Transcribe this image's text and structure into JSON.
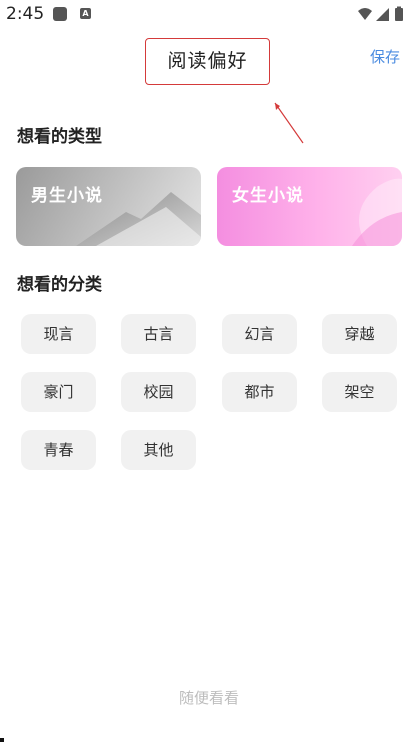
{
  "status_bar": {
    "time": "2:45",
    "icons": [
      "app-icon",
      "keyboard-icon",
      "wifi-icon",
      "signal-icon",
      "battery-icon"
    ],
    "notif_letter": "A"
  },
  "header": {
    "title": "阅读偏好",
    "save_label": "保存",
    "accent_color": "#4a8be0",
    "highlight_color": "#d43a3a"
  },
  "types_section": {
    "title": "想看的类型",
    "cards": [
      {
        "label": "男生小说",
        "colors": [
          "#9a9a9a",
          "#e6e6e6"
        ]
      },
      {
        "label": "女生小说",
        "colors": [
          "#f48ee0",
          "#ffd0f0"
        ]
      }
    ]
  },
  "categories_section": {
    "title": "想看的分类",
    "chips": [
      "现言",
      "古言",
      "幻言",
      "穿越",
      "豪门",
      "校园",
      "都市",
      "架空",
      "青春",
      "其他"
    ]
  },
  "footer": {
    "random_label": "随便看看"
  }
}
